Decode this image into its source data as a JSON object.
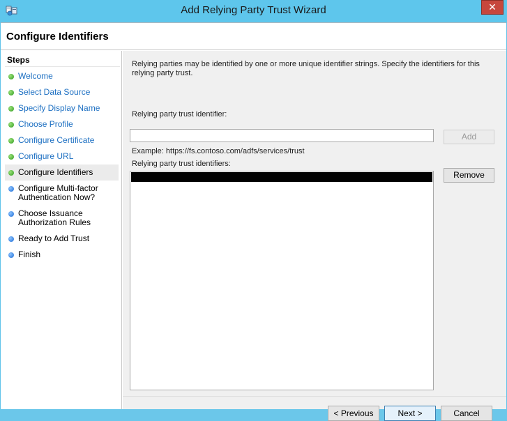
{
  "window": {
    "title": "Add Relying Party Trust Wizard",
    "close_glyph": "✕"
  },
  "page": {
    "title": "Configure Identifiers"
  },
  "steps": {
    "heading": "Steps",
    "items": [
      {
        "label": "Welcome",
        "status": "complete",
        "color": "green"
      },
      {
        "label": "Select Data Source",
        "status": "complete",
        "color": "green"
      },
      {
        "label": "Specify Display Name",
        "status": "complete",
        "color": "green"
      },
      {
        "label": "Choose Profile",
        "status": "complete",
        "color": "green"
      },
      {
        "label": "Configure Certificate",
        "status": "complete",
        "color": "green"
      },
      {
        "label": "Configure URL",
        "status": "complete",
        "color": "green"
      },
      {
        "label": "Configure Identifiers",
        "status": "current",
        "color": "green"
      },
      {
        "label": "Configure Multi-factor Authentication Now?",
        "status": "pending",
        "color": "blue"
      },
      {
        "label": "Choose Issuance Authorization Rules",
        "status": "pending",
        "color": "blue"
      },
      {
        "label": "Ready to Add Trust",
        "status": "pending",
        "color": "blue"
      },
      {
        "label": "Finish",
        "status": "pending",
        "color": "blue"
      }
    ]
  },
  "main": {
    "intro": "Relying parties may be identified by one or more unique identifier strings. Specify the identifiers for this relying party trust.",
    "identifier_label": "Relying party trust identifier:",
    "identifier_value": "",
    "add_label": "Add",
    "example": "Example: https://fs.contoso.com/adfs/services/trust",
    "identifiers_label": "Relying party trust identifiers:",
    "identifiers": [
      ""
    ],
    "remove_label": "Remove"
  },
  "footer": {
    "previous_label": "< Previous",
    "next_label": "Next >",
    "cancel_label": "Cancel"
  },
  "colors": {
    "titlebar": "#5ec6ec",
    "link": "#1c6fc2",
    "close": "#c7473d"
  }
}
